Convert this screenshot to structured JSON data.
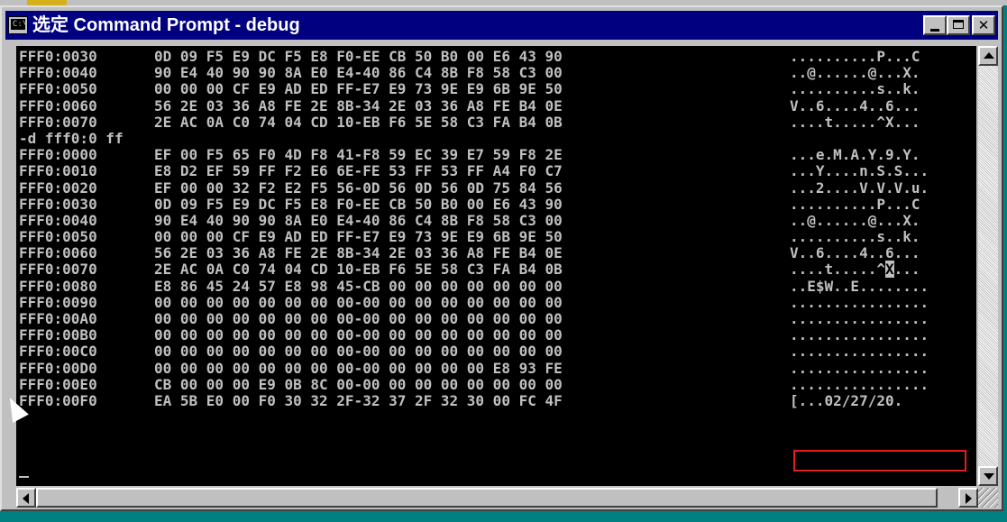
{
  "window": {
    "title": "选定 Command Prompt - debug",
    "sysicon_text": "C:\\",
    "buttons": {
      "minimize": "",
      "maximize": "",
      "close": "✕"
    }
  },
  "console": {
    "lines": [
      {
        "addr": "FFF0:0030",
        "hex": "0D 09 F5 E9 DC F5 E8 F0-EE CB 50 B0 00 E6 43 90",
        "ascii": "..........P...C"
      },
      {
        "addr": "FFF0:0040",
        "hex": "90 E4 40 90 90 8A E0 E4-40 86 C4 8B F8 58 C3 00",
        "ascii": "..@......@...X."
      },
      {
        "addr": "FFF0:0050",
        "hex": "00 00 00 CF E9 AD ED FF-E7 E9 73 9E E9 6B 9E 50",
        "ascii": "..........s..k."
      },
      {
        "addr": "FFF0:0060",
        "hex": "56 2E 03 36 A8 FE 2E 8B-34 2E 03 36 A8 FE B4 0E",
        "ascii": "V..6....4..6..."
      },
      {
        "addr": "FFF0:0070",
        "hex": "2E AC 0A C0 74 04 CD 10-EB F6 5E 58 C3 FA B4 0B",
        "ascii": "....t.....^X..."
      },
      {
        "addr": "-d fff0:0 ff",
        "hex": "",
        "ascii": ""
      },
      {
        "addr": "FFF0:0000",
        "hex": "EF 00 F5 65 F0 4D F8 41-F8 59 EC 39 E7 59 F8 2E",
        "ascii": "...e.M.A.Y.9.Y."
      },
      {
        "addr": "FFF0:0010",
        "hex": "E8 D2 EF 59 FF F2 E6 6E-FE 53 FF 53 FF A4 F0 C7",
        "ascii": "...Y....n.S.S..."
      },
      {
        "addr": "FFF0:0020",
        "hex": "EF 00 00 32 F2 E2 F5 56-0D 56 0D 56 0D 75 84 56",
        "ascii": "...2....V.V.V.u."
      },
      {
        "addr": "FFF0:0030",
        "hex": "0D 09 F5 E9 DC F5 E8 F0-EE CB 50 B0 00 E6 43 90",
        "ascii": "..........P...C"
      },
      {
        "addr": "FFF0:0040",
        "hex": "90 E4 40 90 90 8A E0 E4-40 86 C4 8B F8 58 C3 00",
        "ascii": "..@......@...X."
      },
      {
        "addr": "FFF0:0050",
        "hex": "00 00 00 CF E9 AD ED FF-E7 E9 73 9E E9 6B 9E 50",
        "ascii": "..........s..k."
      },
      {
        "addr": "FFF0:0060",
        "hex": "56 2E 03 36 A8 FE 2E 8B-34 2E 03 36 A8 FE B4 0E",
        "ascii": "V..6....4..6..."
      },
      {
        "addr": "FFF0:0070",
        "hex": "2E AC 0A C0 74 04 CD 10-EB F6 5E 58 C3 FA B4 0B",
        "ascii": "....t.....^X..."
      },
      {
        "addr": "FFF0:0080",
        "hex": "E8 86 45 24 57 E8 98 45-CB 00 00 00 00 00 00 00",
        "ascii": "..E$W..E........"
      },
      {
        "addr": "FFF0:0090",
        "hex": "00 00 00 00 00 00 00 00-00 00 00 00 00 00 00 00",
        "ascii": "................"
      },
      {
        "addr": "FFF0:00A0",
        "hex": "00 00 00 00 00 00 00 00-00 00 00 00 00 00 00 00",
        "ascii": "................"
      },
      {
        "addr": "FFF0:00B0",
        "hex": "00 00 00 00 00 00 00 00-00 00 00 00 00 00 00 00",
        "ascii": "................"
      },
      {
        "addr": "FFF0:00C0",
        "hex": "00 00 00 00 00 00 00 00-00 00 00 00 00 00 00 00",
        "ascii": "................"
      },
      {
        "addr": "FFF0:00D0",
        "hex": "00 00 00 00 00 00 00 00-00 00 00 00 00 E8 93 FE",
        "ascii": "................"
      },
      {
        "addr": "FFF0:00E0",
        "hex": "CB 00 00 00 E9 0B 8C 00-00 00 00 00 00 00 00 00",
        "ascii": "................"
      },
      {
        "addr": "FFF0:00F0",
        "hex": "EA 5B E0 00 F0 30 32 2F-32 37 2F 32 30 00 FC 4F",
        "ascii": "[...02/27/20."
      }
    ],
    "selected_char_line": 13,
    "selected_char": "X",
    "highlighted_line": 21,
    "prompt_cursor": "_"
  }
}
